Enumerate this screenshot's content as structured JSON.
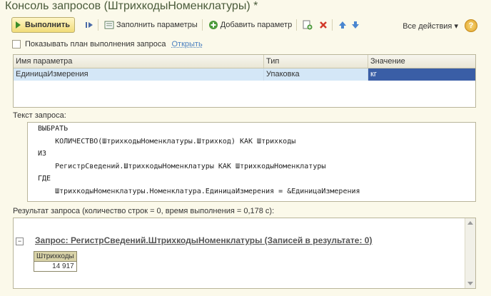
{
  "window": {
    "title": "Консоль запросов (ШтрихкодыНоменклатуры) *"
  },
  "toolbar": {
    "execute_label": "Выполнить",
    "fill_params_label": "Заполнить параметры",
    "add_param_label": "Добавить параметр",
    "all_actions_label": "Все действия",
    "help_label": "?"
  },
  "options": {
    "show_plan_label": "Показывать план выполнения запроса",
    "open_link": "Открыть"
  },
  "params_table": {
    "columns": [
      "Имя параметра",
      "Тип",
      "Значение"
    ],
    "rows": [
      {
        "name": "ЕдиницаИзмерения",
        "type": "Упаковка",
        "value": "кг"
      }
    ]
  },
  "query": {
    "label": "Текст запроса:",
    "lines": [
      "ВЫБРАТЬ",
      "    КОЛИЧЕСТВО(ШтрихкодыНоменклатуры.Штрихкод) КАК Штрихкоды",
      "ИЗ",
      "    РегистрСведений.ШтрихкодыНоменклатуры КАК ШтрихкодыНоменклатуры",
      "ГДЕ",
      "    ШтрихкодыНоменклатуры.Номенклатура.ЕдиницаИзмерения = &ЕдиницаИзмерения"
    ]
  },
  "result": {
    "label": "Результат запроса (количество строк = 0, время выполнения = 0,178 с):",
    "title": "Запрос: РегистрСведений.ШтрихкодыНоменклатуры (Записей в результате: 0)",
    "collapse_symbol": "−",
    "column": "Штрихкоды",
    "value": "14 917"
  },
  "colors": {
    "accent": "#3a5ea6",
    "selected_row": "#d4e7f7",
    "link": "#4a7fbf"
  }
}
